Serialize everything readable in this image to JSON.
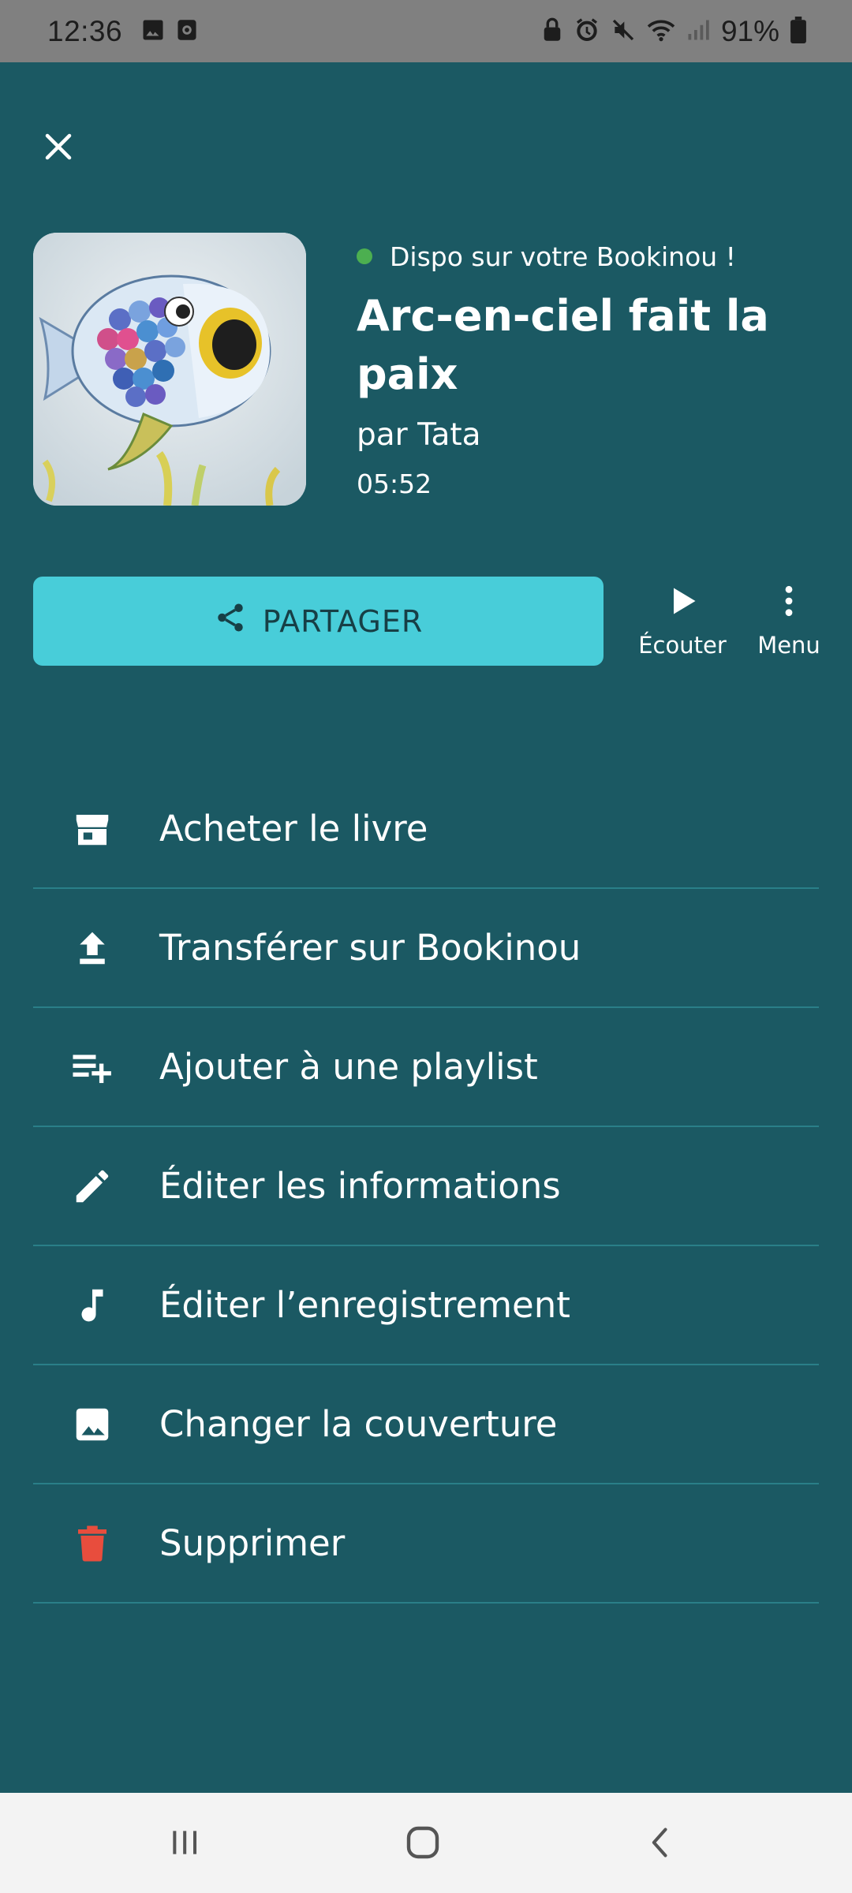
{
  "status_bar": {
    "time": "12:36",
    "battery": "91%",
    "left_icons": [
      "image-icon",
      "camera-icon"
    ],
    "right_icons": [
      "lock-icon",
      "alarm-icon",
      "mute-icon",
      "wifi-icon",
      "signal-icon",
      "battery-icon"
    ]
  },
  "header": {
    "close_icon": "close-icon",
    "availability": "Dispo sur votre Bookinou !",
    "availability_color": "#4caf50",
    "title": "Arc-en-ciel fait la paix",
    "author": "par Tata",
    "duration": "05:52"
  },
  "actions": {
    "share_label": "PARTAGER",
    "listen_label": "Écouter",
    "menu_label": "Menu"
  },
  "menu": {
    "items": [
      {
        "label": "Acheter le livre",
        "icon": "store-icon"
      },
      {
        "label": "Transférer sur Bookinou",
        "icon": "upload-icon"
      },
      {
        "label": "Ajouter à une playlist",
        "icon": "playlist-add-icon"
      },
      {
        "label": "Éditer les informations",
        "icon": "pencil-icon"
      },
      {
        "label": "Éditer l’enregistrement",
        "icon": "music-note-icon"
      },
      {
        "label": "Changer la couverture",
        "icon": "image-icon"
      },
      {
        "label": "Supprimer",
        "icon": "trash-icon"
      }
    ]
  },
  "colors": {
    "background": "#1b5963",
    "share_button": "#48cdd9",
    "delete_icon": "#e84d3d",
    "divider": "#2a7f88"
  }
}
